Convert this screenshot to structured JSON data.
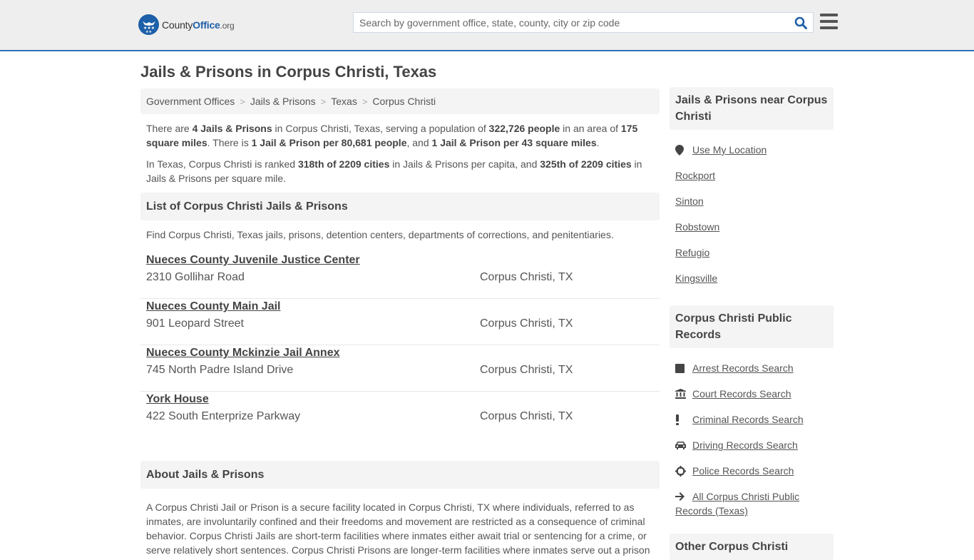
{
  "header": {
    "logo": {
      "county": "County",
      "office": "Office",
      "org": ".org"
    },
    "search_placeholder": "Search by government office, state, county, city or zip code",
    "search_value": ""
  },
  "page_title": "Jails & Prisons in Corpus Christi, Texas",
  "breadcrumb": [
    {
      "label": "Government Offices"
    },
    {
      "label": "Jails & Prisons"
    },
    {
      "label": "Texas"
    },
    {
      "label": "Corpus Christi"
    }
  ],
  "breadcrumb_separator": ">",
  "intro": {
    "p1": {
      "t1": "There are ",
      "b1": "4 Jails & Prisons",
      "t2": " in Corpus Christi, Texas, serving a population of ",
      "b2": "322,726 people",
      "t3": " in an area of ",
      "b3": "175 square miles",
      "t4": ". There is ",
      "b4": "1 Jail & Prison per 80,681 people",
      "t5": ", and ",
      "b5": "1 Jail & Prison per 43 square miles",
      "t6": "."
    },
    "p2": {
      "t1": "In Texas, Corpus Christi is ranked ",
      "b1": "318th of 2209 cities",
      "t2": " in Jails & Prisons per capita, and ",
      "b2": "325th of 2209 cities",
      "t3": " in Jails & Prisons per square mile."
    }
  },
  "list_section": {
    "title": "List of Corpus Christi Jails & Prisons",
    "description": "Find Corpus Christi, Texas jails, prisons, detention centers, departments of corrections, and penitentiaries.",
    "facilities": [
      {
        "name": "Nueces County Juvenile Justice Center",
        "address": "2310 Gollihar Road",
        "city": "Corpus Christi, TX"
      },
      {
        "name": "Nueces County Main Jail",
        "address": "901 Leopard Street",
        "city": "Corpus Christi, TX"
      },
      {
        "name": "Nueces County Mckinzie Jail Annex",
        "address": "745 North Padre Island Drive",
        "city": "Corpus Christi, TX"
      },
      {
        "name": "York House",
        "address": "422 South Enterprize Parkway",
        "city": "Corpus Christi, TX"
      }
    ]
  },
  "about_section": {
    "title": "About Jails & Prisons",
    "text": "A Corpus Christi Jail or Prison is a secure facility located in Corpus Christi, TX where individuals, referred to as inmates, are involuntarily confined and their freedoms and movement are restricted as a consequence of criminal behavior. Corpus Christi Jails are short-term facilities where inmates either await trial or sentencing for a crime, or serve relatively short sentences. Corpus Christi Prisons are longer-term facilities where inmates serve out a prison"
  },
  "sidebar": {
    "nearby": {
      "title": "Jails & Prisons near Corpus Christi",
      "use_location": "Use My Location",
      "cities": [
        "Rockport",
        "Sinton",
        "Robstown",
        "Refugio",
        "Kingsville"
      ]
    },
    "records": {
      "title": "Corpus Christi Public Records",
      "items": [
        {
          "label": "Arrest Records Search",
          "icon": "square-icon"
        },
        {
          "label": "Court Records Search",
          "icon": "courthouse-icon"
        },
        {
          "label": "Criminal Records Search",
          "icon": "exclamation-icon"
        },
        {
          "label": "Driving Records Search",
          "icon": "car-icon"
        },
        {
          "label": "Police Records Search",
          "icon": "crosshair-icon"
        },
        {
          "label": "All Corpus Christi Public Records (Texas)",
          "icon": "arrow-right-icon"
        }
      ]
    },
    "other": {
      "title": "Other Corpus Christi"
    }
  }
}
